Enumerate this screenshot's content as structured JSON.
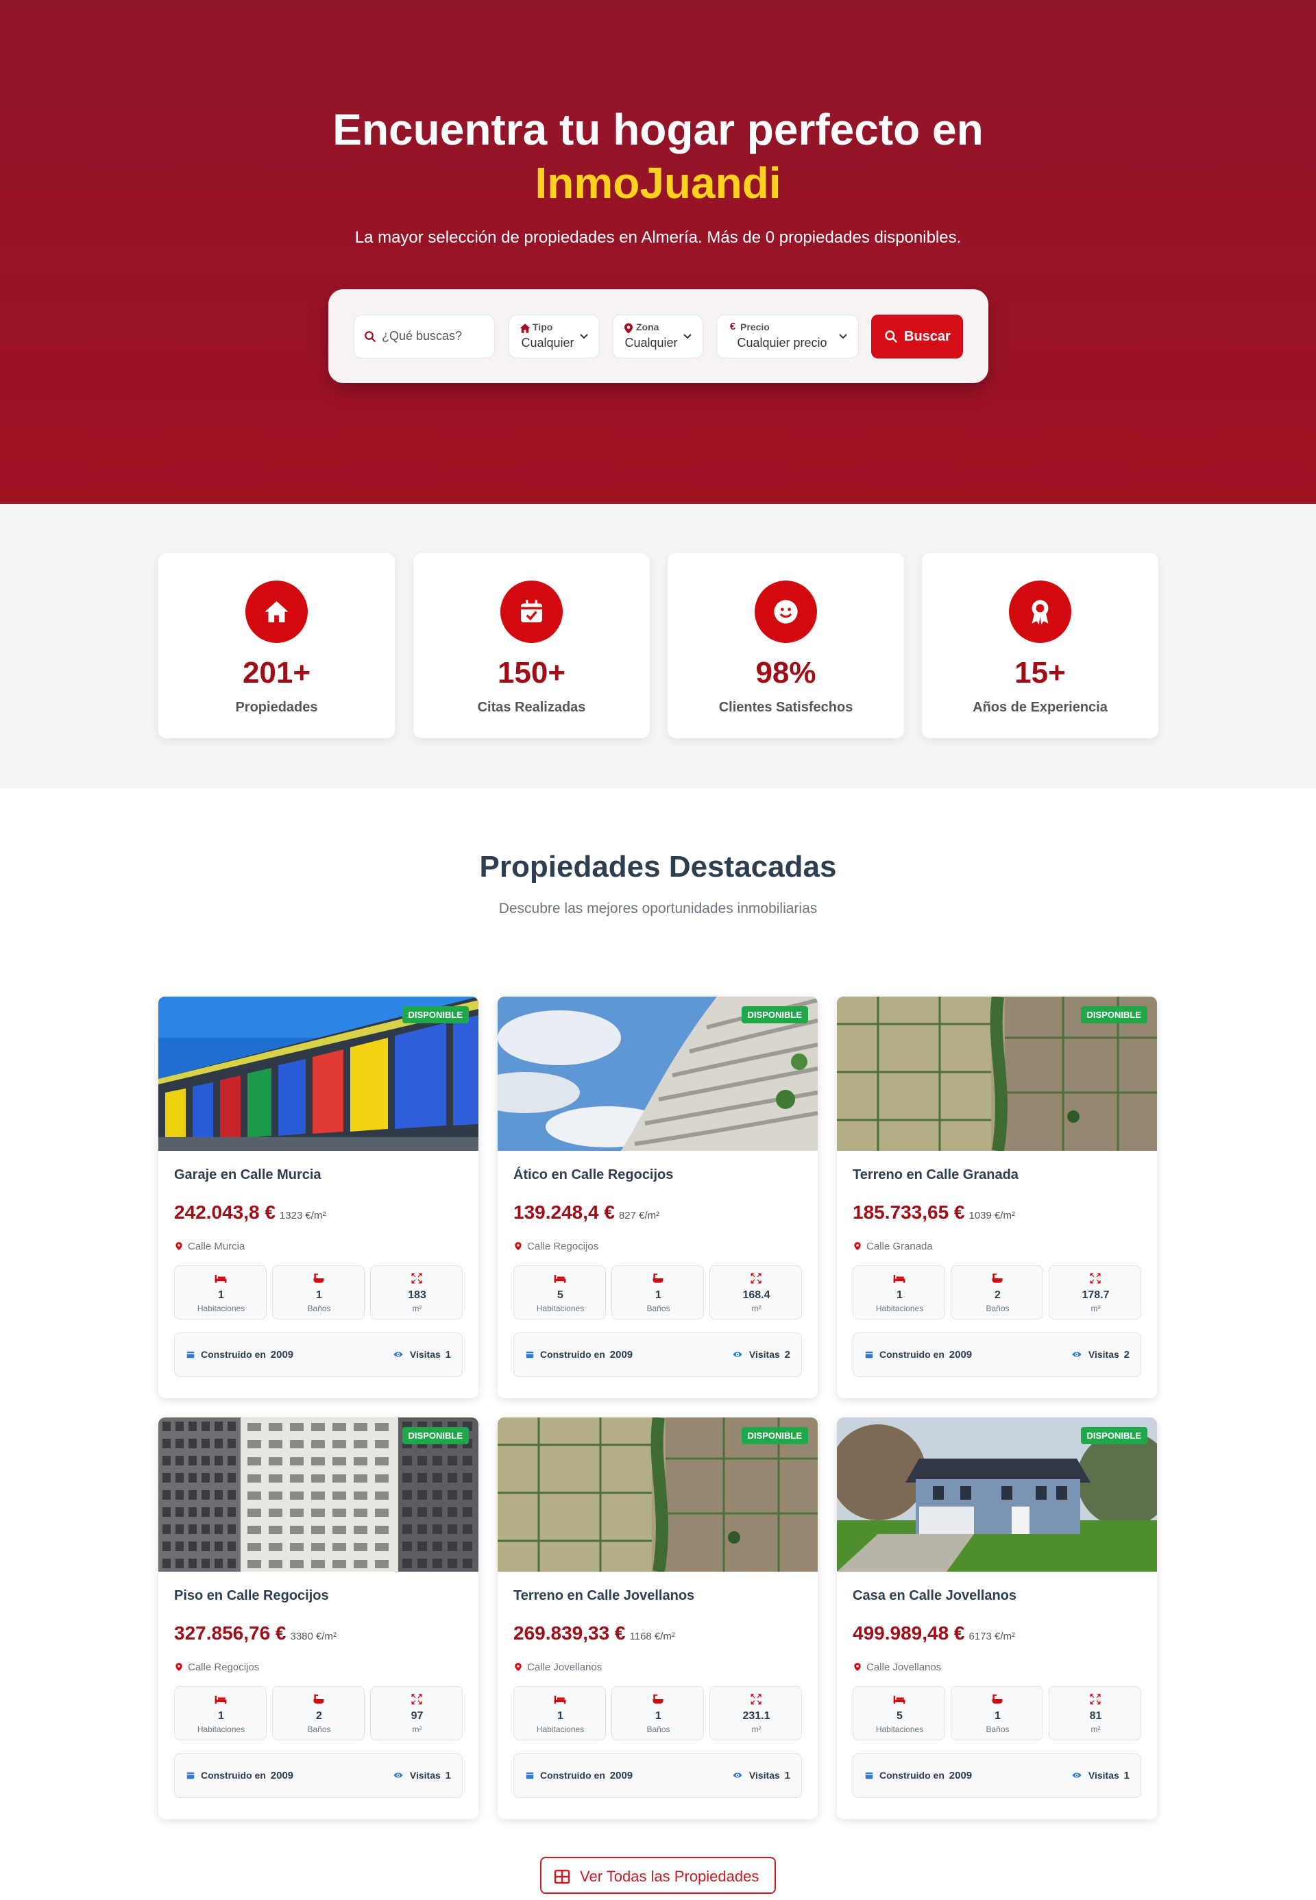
{
  "hero": {
    "title": "Encuentra tu hogar perfecto en",
    "brand": "InmoJuandi",
    "subtitle": "La mayor selección de propiedades en Almería. Más de 0 propiedades disponibles.",
    "search": {
      "query_placeholder": "¿Qué buscas?",
      "tipo_label": "Tipo",
      "tipo_value": "Cualquier",
      "zona_label": "Zona",
      "zona_value": "Cualquier",
      "precio_label": "Precio",
      "precio_value": "Cualquier precio",
      "button": "Buscar"
    }
  },
  "stats": [
    {
      "value": "201+",
      "label": "Propiedades",
      "icon": "home-icon"
    },
    {
      "value": "150+",
      "label": "Citas Realizadas",
      "icon": "calendar-check-icon"
    },
    {
      "value": "98%",
      "label": "Clientes Satisfechos",
      "icon": "smile-icon"
    },
    {
      "value": "15+",
      "label": "Años de Experiencia",
      "icon": "award-icon"
    }
  ],
  "featured": {
    "title": "Propiedades Destacadas",
    "subtitle": "Descubre las mejores oportunidades inmobiliarias",
    "labels": {
      "badge": "DISPONIBLE",
      "rooms": "Habitaciones",
      "baths": "Baños",
      "area": "m²",
      "built": "Construido en",
      "visits": "Visitas"
    },
    "properties": [
      {
        "title": "Garaje en Calle Murcia",
        "price": "242.043,8 €",
        "ppm": "1323 €/m²",
        "location": "Calle Murcia",
        "rooms": "1",
        "baths": "1",
        "area": "183",
        "year": "2009",
        "visits": "1",
        "image": "garage"
      },
      {
        "title": "Ático en Calle Regocijos",
        "price": "139.248,4 €",
        "ppm": "827 €/m²",
        "location": "Calle Regocijos",
        "rooms": "5",
        "baths": "1",
        "area": "168.4",
        "year": "2009",
        "visits": "2",
        "image": "tower"
      },
      {
        "title": "Terreno en Calle Granada",
        "price": "185.733,65 €",
        "ppm": "1039 €/m²",
        "location": "Calle Granada",
        "rooms": "1",
        "baths": "2",
        "area": "178.7",
        "year": "2009",
        "visits": "2",
        "image": "field"
      },
      {
        "title": "Piso en Calle Regocijos",
        "price": "327.856,76 €",
        "ppm": "3380 €/m²",
        "location": "Calle Regocijos",
        "rooms": "1",
        "baths": "2",
        "area": "97",
        "year": "2009",
        "visits": "1",
        "image": "apartments"
      },
      {
        "title": "Terreno en Calle Jovellanos",
        "price": "269.839,33 €",
        "ppm": "1168 €/m²",
        "location": "Calle Jovellanos",
        "rooms": "1",
        "baths": "1",
        "area": "231.1",
        "year": "2009",
        "visits": "1",
        "image": "field"
      },
      {
        "title": "Casa en Calle Jovellanos",
        "price": "499.989,48 €",
        "ppm": "6173 €/m²",
        "location": "Calle Jovellanos",
        "rooms": "5",
        "baths": "1",
        "area": "81",
        "year": "2009",
        "visits": "1",
        "image": "house"
      }
    ],
    "view_all": "Ver Todas las Propiedades"
  },
  "colors": {
    "primary": "#a01124",
    "accent": "#d50d17",
    "brand_yellow": "#ffd21f",
    "badge_green": "#1fa84a"
  }
}
